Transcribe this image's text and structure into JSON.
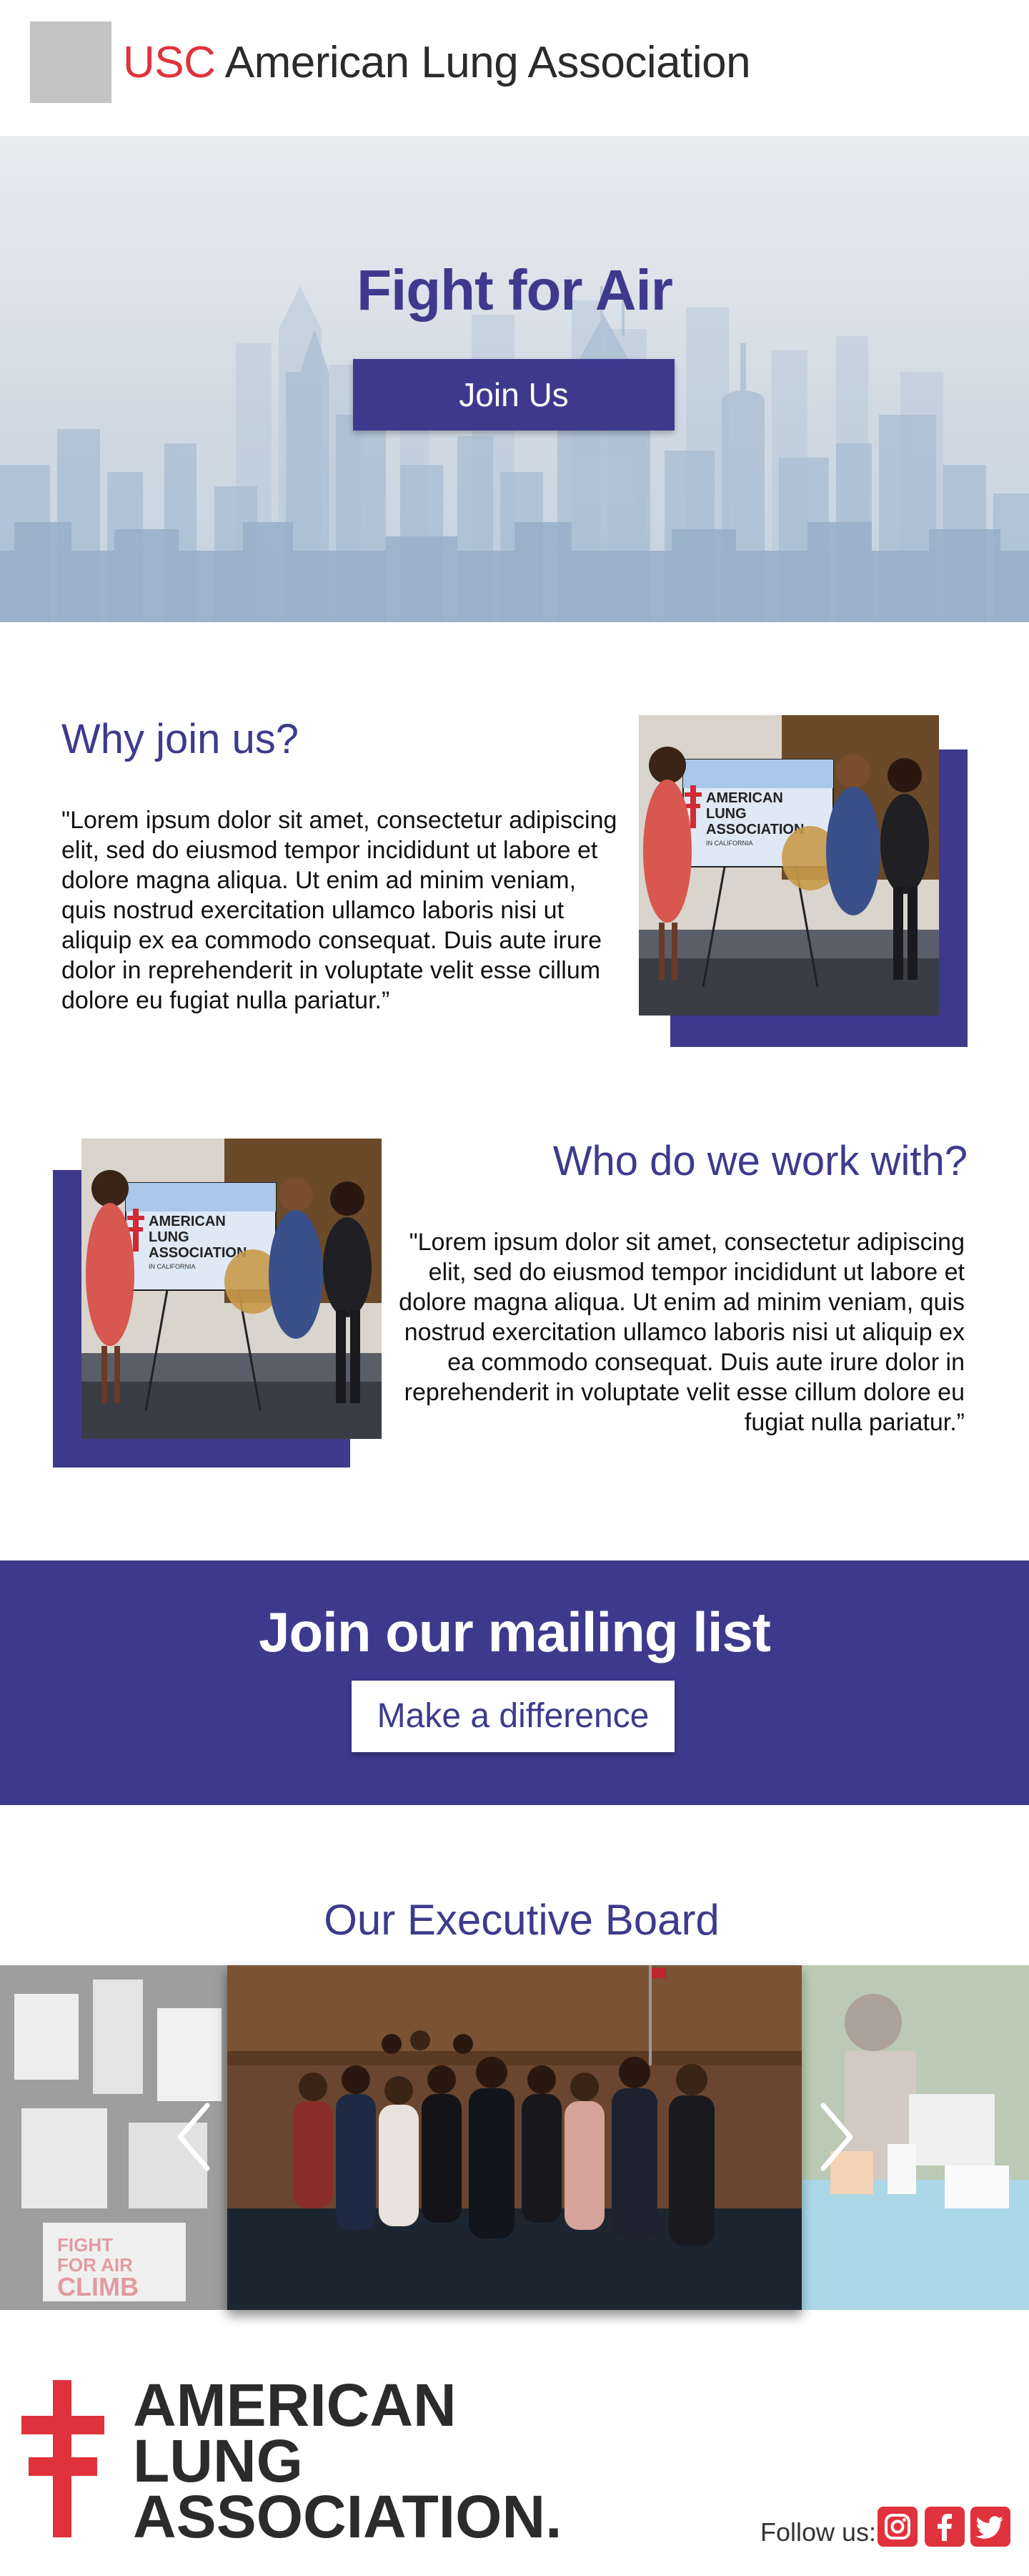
{
  "header": {
    "brand_prefix": "USC",
    "brand_name": "American Lung Association"
  },
  "hero": {
    "title": "Fight for Air",
    "button_label": "Join Us"
  },
  "why": {
    "title": "Why join us?",
    "text": "\"Lorem ipsum dolor sit amet, consectetur adipiscing elit, sed do eiusmod tempor incididunt ut labore et dolore magna aliqua. Ut enim ad minim veniam, quis nostrud exercitation ullamco laboris nisi ut aliquip ex ea commodo consequat. Duis aute irure dolor in reprehenderit in voluptate velit esse cillum dolore eu fugiat nulla pariatur.”",
    "sign_lines": [
      "AMERICAN",
      "LUNG",
      "ASSOCIATION",
      "IN CALIFORNIA"
    ]
  },
  "who": {
    "title": "Who do we work with?",
    "text": "\"Lorem ipsum dolor sit amet, consectetur adipiscing elit, sed do eiusmod tempor incididunt ut labore et dolore magna aliqua. Ut enim ad minim veniam, quis nostrud exercitation ullamco laboris nisi ut aliquip ex ea commodo consequat. Duis aute irure dolor in reprehenderit in voluptate velit esse cillum dolore eu fugiat nulla pariatur.”"
  },
  "mailing": {
    "title": "Join our mailing list",
    "button_label": "Make a difference"
  },
  "board": {
    "title": "Our Executive Board",
    "left_slide_text": [
      "FIGHT",
      "FOR AIR",
      "CLIMB"
    ]
  },
  "footer": {
    "logo_lines": [
      "AMERICAN",
      "LUNG",
      "ASSOCIATION."
    ],
    "follow_label": "Follow us:",
    "social": [
      "instagram-icon",
      "facebook-icon",
      "twitter-icon"
    ]
  },
  "colors": {
    "brand_purple": "#3d3a8e",
    "brand_red": "#e0323c"
  }
}
